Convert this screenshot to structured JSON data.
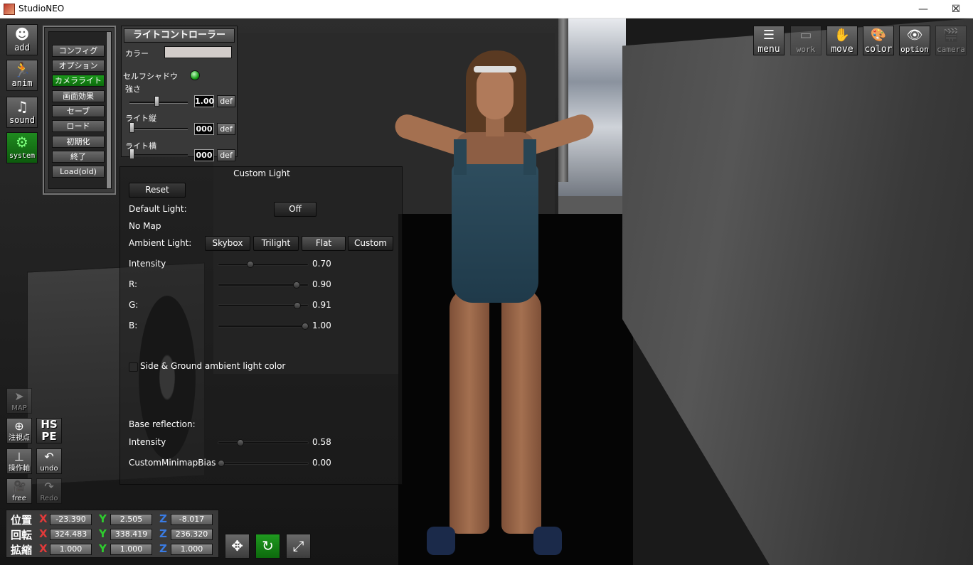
{
  "window": {
    "title": "StudioNEO",
    "min": "—",
    "max": "☐",
    "close": "✕"
  },
  "left_toolbar": [
    {
      "label": "add",
      "icon": "person-add-icon",
      "glyph": "☻"
    },
    {
      "label": "anim",
      "icon": "running-man-icon",
      "glyph": "🏃"
    },
    {
      "label": "sound",
      "icon": "music-note-icon",
      "glyph": "♫"
    },
    {
      "label": "system",
      "icon": "gears-icon",
      "glyph": "⚙"
    }
  ],
  "system_menu": {
    "items": [
      "コンフィグ",
      "オプション",
      "カメラライト",
      "画面効果",
      "セーブ",
      "ロード",
      "初期化",
      "終了",
      "Load(old)"
    ],
    "active_index": 2
  },
  "light_controller": {
    "title": "ライトコントローラー",
    "color_label": "カラー",
    "color": "#d8d2cf",
    "self_shadow_label": "セルフシャドウ",
    "self_shadow_on": true,
    "strength_label": "強さ",
    "strength_value": "1.00",
    "vertical_label": "ライト縦",
    "vertical_value": "000",
    "horizontal_label": "ライト横",
    "horizontal_value": "000",
    "def_label": "def"
  },
  "custom_light": {
    "title": "Custom Light",
    "reset_label": "Reset",
    "default_light_label": "Default Light:",
    "default_light_value": "Off",
    "no_map_label": "No Map",
    "ambient_label": "Ambient Light:",
    "ambient_options": [
      "Skybox",
      "Trilight",
      "Flat",
      "Custom"
    ],
    "ambient_selected": "Flat",
    "intensity_label": "Intensity",
    "intensity_value": "0.70",
    "intensity_level": 0.35,
    "r_label": "R:",
    "r_value": "0.90",
    "r_level": 0.9,
    "g_label": "G:",
    "g_value": "0.91",
    "g_level": 0.91,
    "b_label": "B:",
    "b_value": "1.00",
    "b_level": 1.0,
    "side_ground_label": "Side & Ground ambient light color",
    "side_ground_checked": false,
    "base_reflection_label": "Base reflection:",
    "refl_intensity_label": "Intensity",
    "refl_intensity_value": "0.58",
    "refl_intensity_level": 0.23,
    "minimap_bias_label": "CustomMinimapBias",
    "minimap_bias_value": "0.00",
    "minimap_bias_level": 0.0
  },
  "top_toolbar": [
    {
      "label": "menu",
      "icon": "menu-icon",
      "glyph": "☰",
      "enabled": true
    },
    {
      "label": "work",
      "icon": "work-icon",
      "glyph": "▭",
      "enabled": false
    },
    {
      "label": "move",
      "icon": "hand-icon",
      "glyph": "✋",
      "enabled": true
    },
    {
      "label": "color",
      "icon": "palette-icon",
      "glyph": "🎨",
      "enabled": true
    },
    {
      "label": "option",
      "icon": "eye-icon",
      "glyph": "👁",
      "enabled": true
    },
    {
      "label": "camera",
      "icon": "camera-icon",
      "glyph": "🎬",
      "enabled": false
    }
  ],
  "left_lower_buttons": {
    "map": "MAP",
    "focus": "注視点",
    "hspe_top": "HS",
    "hspe_bottom": "PE",
    "axis": "操作軸",
    "undo": "undo",
    "free": "free",
    "redo": "Redo"
  },
  "transform": {
    "rows": [
      {
        "label": "位置",
        "x": "-23.390",
        "y": "2.505",
        "z": "-8.017"
      },
      {
        "label": "回転",
        "x": "324.483",
        "y": "338.419",
        "z": "236.320"
      },
      {
        "label": "拡縮",
        "x": "1.000",
        "y": "1.000",
        "z": "1.000"
      }
    ],
    "axis_x": "X",
    "axis_y": "Y",
    "axis_z": "Z",
    "colors": {
      "x": "#e23a3a",
      "y": "#2ecc2e",
      "z": "#3a7be2"
    }
  },
  "bottom_buttons": [
    {
      "icon": "move-arrows-icon",
      "glyph": "✥"
    },
    {
      "icon": "rotate-icon",
      "glyph": "↻"
    },
    {
      "icon": "scale-icon",
      "glyph": "⤢"
    }
  ]
}
